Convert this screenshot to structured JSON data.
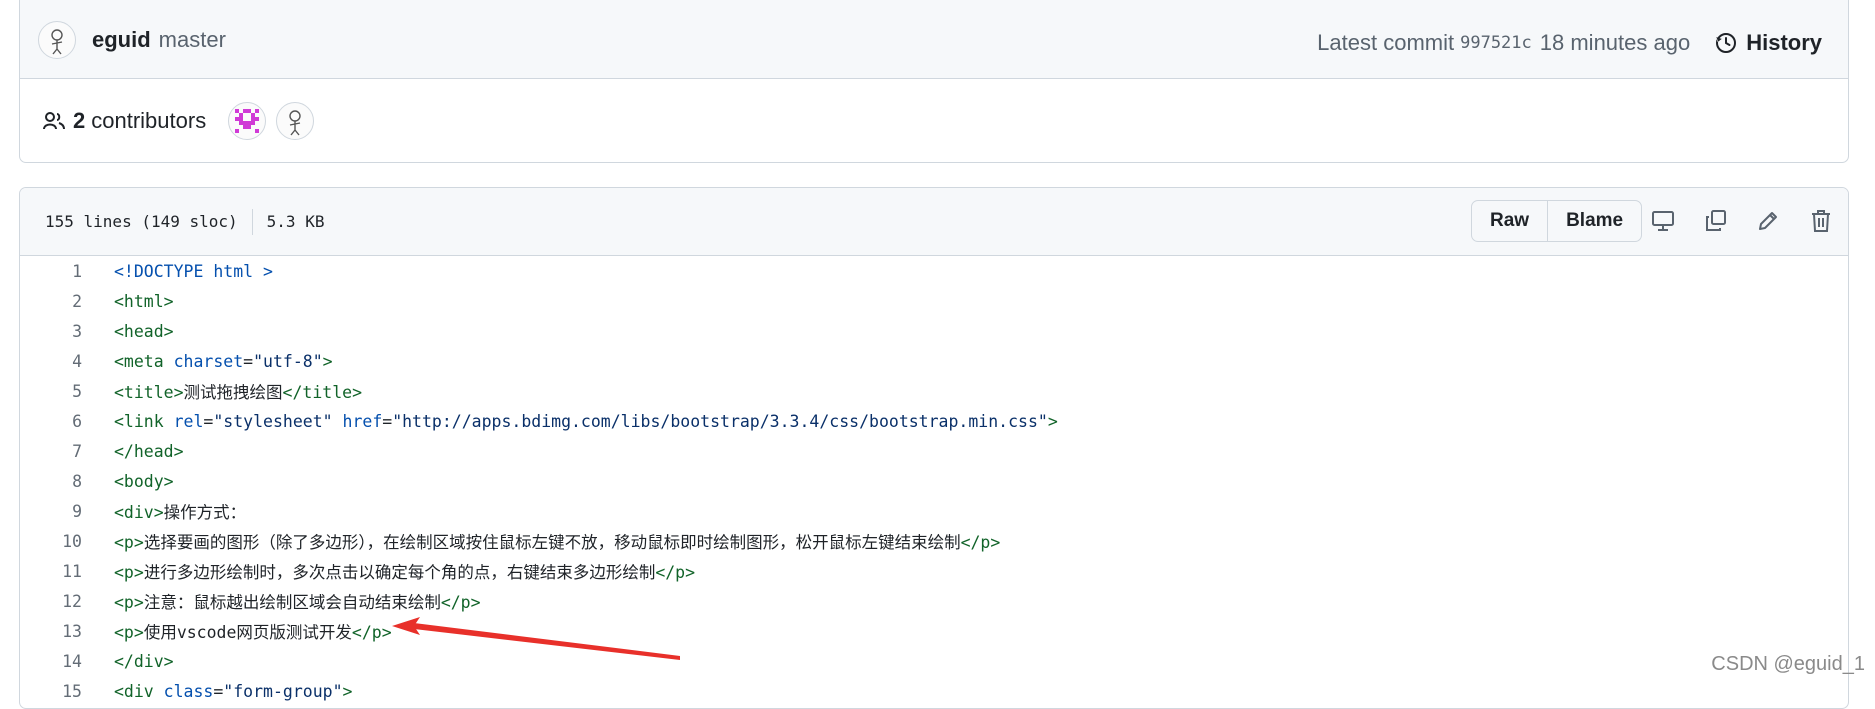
{
  "commit": {
    "author": "eguid",
    "branch": "master",
    "latest_label": "Latest commit",
    "sha": "997521c",
    "time_ago": "18 minutes ago",
    "history_label": "History"
  },
  "contributors": {
    "count": "2",
    "label": "contributors"
  },
  "file": {
    "lines_info": "155 lines (149 sloc)",
    "size": "5.3 KB",
    "raw_label": "Raw",
    "blame_label": "Blame"
  },
  "code": [
    {
      "n": "1",
      "parts": [
        {
          "t": "<!DOCTYPE html >",
          "c": "kw"
        }
      ]
    },
    {
      "n": "2",
      "parts": [
        {
          "t": "<html>",
          "c": "tag"
        }
      ]
    },
    {
      "n": "3",
      "parts": [
        {
          "t": "<head>",
          "c": "tag"
        }
      ]
    },
    {
      "n": "4",
      "parts": [
        {
          "t": "<meta",
          "c": "tag"
        },
        {
          "t": " charset",
          "c": "at"
        },
        {
          "t": "=",
          "c": ""
        },
        {
          "t": "\"utf-8\"",
          "c": "st"
        },
        {
          "t": ">",
          "c": "tag"
        }
      ]
    },
    {
      "n": "5",
      "parts": [
        {
          "t": "<title>",
          "c": "tag"
        },
        {
          "t": "测试拖拽绘图",
          "c": ""
        },
        {
          "t": "</title>",
          "c": "tag"
        }
      ]
    },
    {
      "n": "6",
      "parts": [
        {
          "t": "<link",
          "c": "tag"
        },
        {
          "t": " rel",
          "c": "at"
        },
        {
          "t": "=",
          "c": ""
        },
        {
          "t": "\"stylesheet\"",
          "c": "st"
        },
        {
          "t": " href",
          "c": "at"
        },
        {
          "t": "=",
          "c": ""
        },
        {
          "t": "\"http://apps.bdimg.com/libs/bootstrap/3.3.4/css/bootstrap.min.css\"",
          "c": "st"
        },
        {
          "t": ">",
          "c": "tag"
        }
      ]
    },
    {
      "n": "7",
      "parts": [
        {
          "t": "</head>",
          "c": "tag"
        }
      ]
    },
    {
      "n": "8",
      "parts": [
        {
          "t": "<body>",
          "c": "tag"
        }
      ]
    },
    {
      "n": "9",
      "parts": [
        {
          "t": "<div>",
          "c": "tag"
        },
        {
          "t": "操作方式：",
          "c": ""
        }
      ]
    },
    {
      "n": "10",
      "parts": [
        {
          "t": "<p>",
          "c": "tag"
        },
        {
          "t": "选择要画的图形（除了多边形），在绘制区域按住鼠标左键不放，移动鼠标即时绘制图形，松开鼠标左键结束绘制",
          "c": ""
        },
        {
          "t": "</p>",
          "c": "tag"
        }
      ]
    },
    {
      "n": "11",
      "parts": [
        {
          "t": "<p>",
          "c": "tag"
        },
        {
          "t": "进行多边形绘制时，多次点击以确定每个角的点，右键结束多边形绘制",
          "c": ""
        },
        {
          "t": "</p>",
          "c": "tag"
        }
      ]
    },
    {
      "n": "12",
      "parts": [
        {
          "t": "<p>",
          "c": "tag"
        },
        {
          "t": "注意：鼠标越出绘制区域会自动结束绘制",
          "c": ""
        },
        {
          "t": "</p>",
          "c": "tag"
        }
      ]
    },
    {
      "n": "13",
      "parts": [
        {
          "t": "<p>",
          "c": "tag"
        },
        {
          "t": "使用vscode网页版测试开发",
          "c": ""
        },
        {
          "t": "</p>",
          "c": "tag"
        }
      ]
    },
    {
      "n": "14",
      "parts": [
        {
          "t": "</div>",
          "c": "tag"
        }
      ]
    },
    {
      "n": "15",
      "parts": [
        {
          "t": "<div",
          "c": "tag"
        },
        {
          "t": " class",
          "c": "at"
        },
        {
          "t": "=",
          "c": ""
        },
        {
          "t": "\"form-group\"",
          "c": "st"
        },
        {
          "t": ">",
          "c": "tag"
        }
      ]
    }
  ],
  "colors": {
    "tag": "#116329",
    "keyword": "#0550ae",
    "string": "#0a3069",
    "arrow": "#e8302a"
  },
  "icons": {
    "history": "clock-history-icon",
    "people": "people-icon",
    "display": "desktop-icon",
    "copy": "copy-icon",
    "edit": "pencil-icon",
    "delete": "trash-icon"
  },
  "watermark": "CSDN @eguid_1"
}
